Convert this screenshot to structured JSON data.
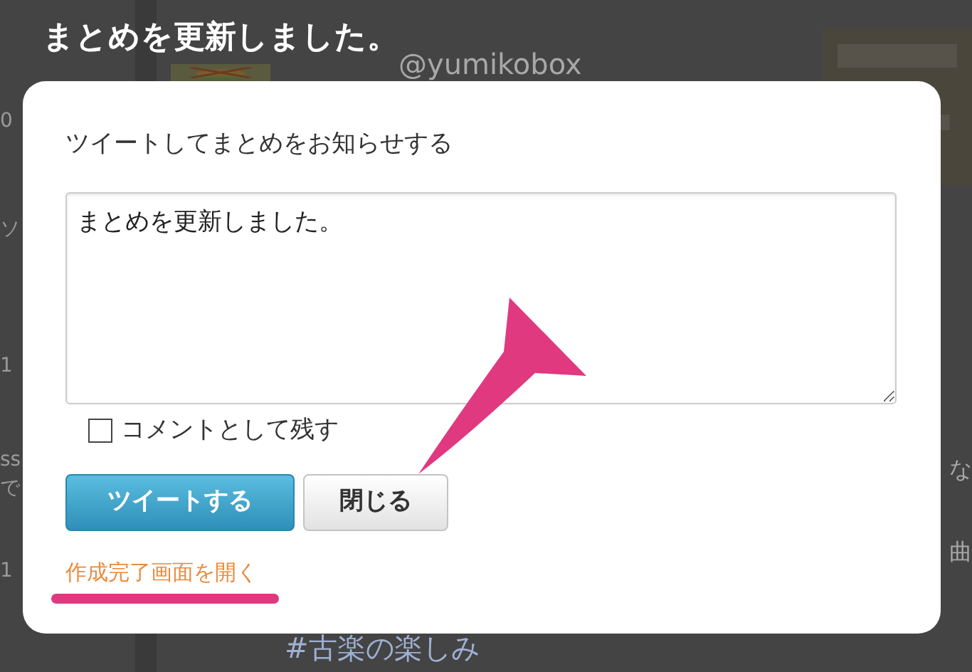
{
  "background": {
    "left_fragments": [
      "0",
      "ソ",
      "1",
      "ss",
      "で",
      "1"
    ],
    "handle": "@yumikobox",
    "right_fragments": [
      "な",
      "曲"
    ],
    "hashtag": "#古楽の楽しみ"
  },
  "dialog": {
    "heading": "まとめを更新しました。",
    "prompt": "ツイートしてまとめをお知らせする",
    "message": {
      "value": "まとめを更新しました。"
    },
    "keep_comment": {
      "label": "コメントとして残す",
      "checked": false
    },
    "buttons": [
      {
        "kind": "primary",
        "label": "ツイートする"
      },
      {
        "kind": "secondary",
        "label": "閉じる"
      }
    ],
    "link": "作成完了画面を開く"
  }
}
